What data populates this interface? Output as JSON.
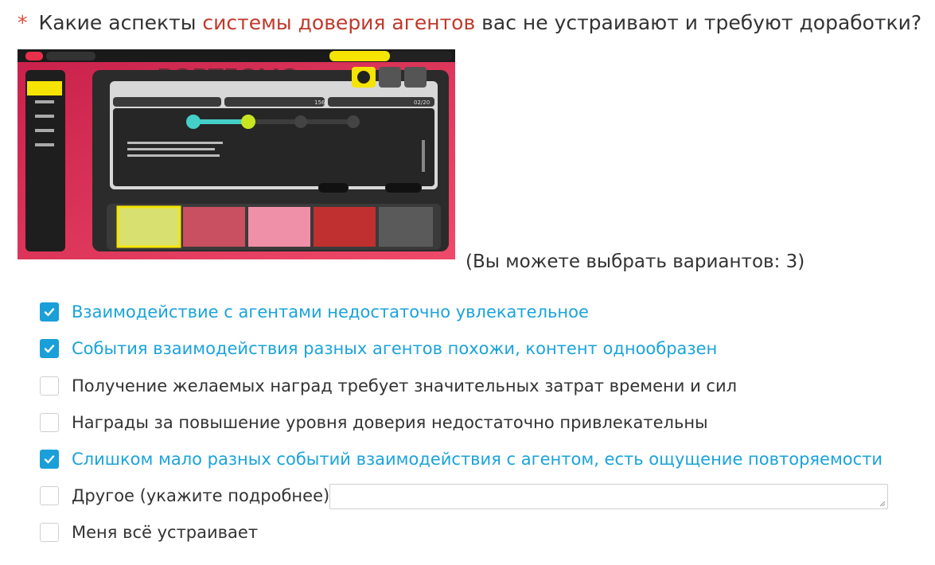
{
  "question": {
    "required_mark": "*",
    "text_before": "Какие аспекты ",
    "text_highlight": "системы доверия агентов",
    "text_after": " вас не устраивают и требуют доработки?"
  },
  "hint": "(Вы можете выбрать вариантов: 3)",
  "options": [
    {
      "label": "Взаимодействие с агентами недостаточно увлекательное",
      "checked": true
    },
    {
      "label": "События взаимодействия разных агентов похожи, контент однообразен",
      "checked": true
    },
    {
      "label": "Получение желаемых наград требует значительных затрат времени и сил",
      "checked": false
    },
    {
      "label": "Награды за повышение уровня доверия недостаточно привлекательны",
      "checked": false
    },
    {
      "label": "Слишком мало разных событий взаимодействия с агентом, есть ощущение повторяемости",
      "checked": true
    },
    {
      "label": "Другое (укажите подробнее)",
      "checked": false
    },
    {
      "label": "Меня всё устраивает",
      "checked": false
    }
  ],
  "other_input": {
    "value": "",
    "placeholder": ""
  },
  "screenshot": {
    "progress_left": "156",
    "progress_right": "02/20",
    "colors": {
      "accent_yellow": "#f5e400",
      "panel_dark": "#2a2a2a",
      "bg_pink": "#e0325a"
    }
  }
}
